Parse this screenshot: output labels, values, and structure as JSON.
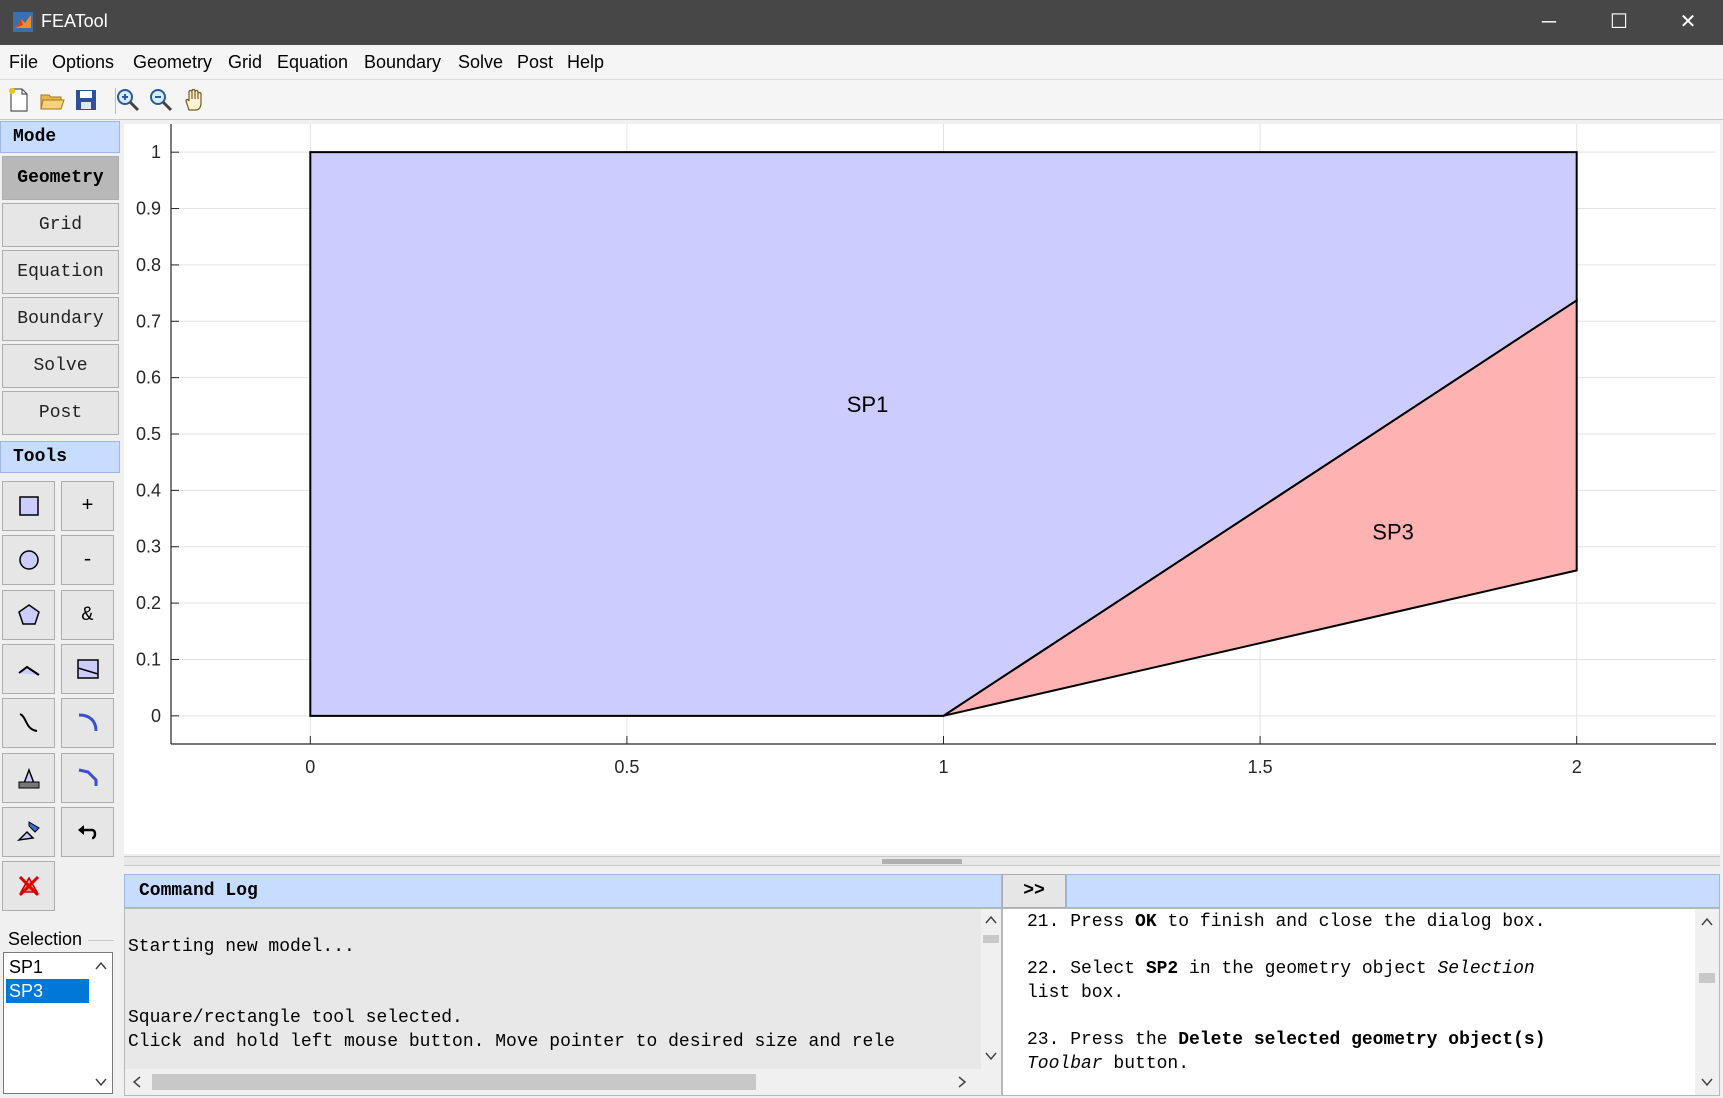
{
  "window": {
    "title": "FEATool",
    "minimize_glyph": "─",
    "maximize_glyph": "☐",
    "close_glyph": "✕"
  },
  "menu": [
    "File",
    "Options",
    "Geometry",
    "Grid",
    "Equation",
    "Boundary",
    "Solve",
    "Post",
    "Help"
  ],
  "toolbar": {
    "icons": [
      "new-file-icon",
      "open-folder-icon",
      "save-icon",
      "zoom-in-icon",
      "zoom-out-icon",
      "pan-hand-icon"
    ]
  },
  "mode": {
    "header": "Mode",
    "buttons": [
      "Geometry",
      "Grid",
      "Equation",
      "Boundary",
      "Solve",
      "Post"
    ],
    "active": "Geometry"
  },
  "tools": {
    "header": "Tools",
    "union_label": "+",
    "subtract_label": "-",
    "intersect_label": "&"
  },
  "selection": {
    "label": "Selection",
    "items": [
      "SP1",
      "SP3"
    ],
    "selected": "SP3"
  },
  "plot": {
    "x_ticks": [
      "0",
      "0.5",
      "1",
      "1.5",
      "2"
    ],
    "y_ticks": [
      "0",
      "0.1",
      "0.2",
      "0.3",
      "0.4",
      "0.5",
      "0.6",
      "0.7",
      "0.8",
      "0.9",
      "1"
    ],
    "xlim": [
      -0.22,
      2.22
    ],
    "ylim": [
      -0.05,
      1.05
    ],
    "grid": true,
    "objects": [
      {
        "name": "SP1",
        "color": "#ccccff",
        "vertices": [
          [
            0,
            0
          ],
          [
            1,
            0
          ],
          [
            2,
            0.737
          ],
          [
            2,
            1
          ],
          [
            0,
            1
          ]
        ],
        "label_pos": [
          0.88,
          0.553
        ]
      },
      {
        "name": "SP3",
        "color": "#ffb2b2",
        "vertices": [
          [
            1,
            0
          ],
          [
            2,
            0.258
          ],
          [
            2,
            0.737
          ]
        ],
        "label_pos": [
          1.71,
          0.327
        ]
      }
    ]
  },
  "command_log": {
    "header": "Command Log",
    "expand_label": ">>",
    "lines": [
      "Starting new model...",
      "Square/rectangle tool selected.",
      "Click and hold left mouse button. Move pointer to desired size and rele"
    ]
  },
  "help": {
    "step21": {
      "pre": "21. Press ",
      "b1": "OK",
      "post": " to finish and close the dialog box."
    },
    "step22": {
      "pre": "22. Select ",
      "b1": "SP2",
      "mid": " in the geometry object ",
      "i1": "Selection",
      "line2": "list box."
    },
    "step23": {
      "pre": "23. Press the ",
      "b1": "Delete selected geometry object(s)",
      "i1": "Toolbar",
      "line2": " button."
    }
  }
}
